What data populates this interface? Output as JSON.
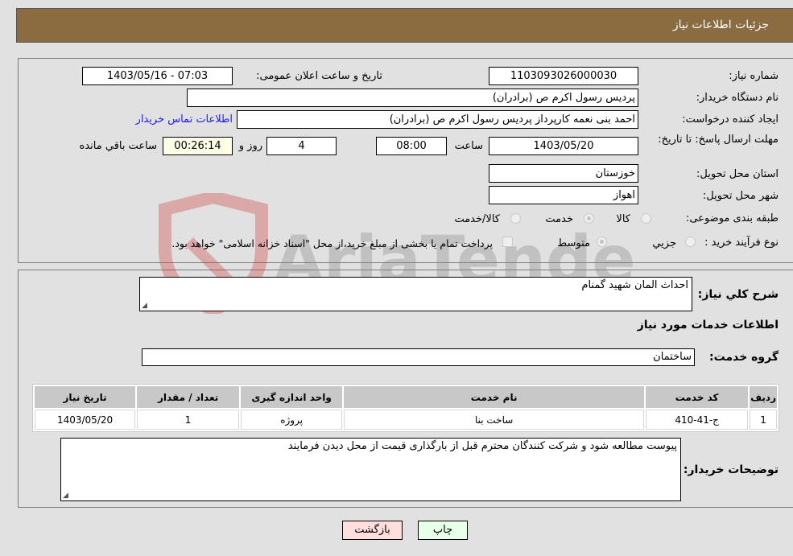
{
  "header": {
    "title": "جزئیات اطلاعات نیاز"
  },
  "fields": {
    "need_number": {
      "label": "شماره نیاز:",
      "value": "1103093026000030"
    },
    "announce_datetime": {
      "label": "تاریخ و ساعت اعلان عمومی:",
      "value": "1403/05/16 - 07:03"
    },
    "buyer_org": {
      "label": "نام دستگاه خریدار:",
      "value": "پردیس رسول اکرم ص (برادران)"
    },
    "requester": {
      "label": "ایجاد کننده درخواست:",
      "value": "احمد بنی نعمه کارپرداز پردیس رسول اکرم ص (برادران)"
    },
    "buyer_contact_link": "اطلاعات تماس خریدار",
    "deadline": {
      "label": "مهلت ارسال پاسخ: تا تاریخ:",
      "date": "1403/05/20",
      "time_label": "ساعت",
      "time": "08:00",
      "days": "4",
      "days_label": "روز و",
      "remaining": "00:26:14",
      "remaining_label": "ساعت باقي مانده"
    },
    "province": {
      "label": "استان محل تحویل:",
      "value": "خوزستان"
    },
    "city": {
      "label": "شهر محل تحویل:",
      "value": "اهواز"
    },
    "category": {
      "label": "طبقه بندی موضوعی:",
      "options": [
        "کالا",
        "خدمت",
        "کالا/خدمت"
      ],
      "selected": "خدمت"
    },
    "purchase_process": {
      "label": "نوع فرآیند خرید :",
      "options": [
        "جزيي",
        "متوسط"
      ],
      "selected": "متوسط",
      "treasury_note": "پرداخت تمام یا بخشی از مبلغ خرید،از محل \"اسناد خزانه اسلامی\" خواهد بود."
    }
  },
  "description": {
    "label": "شرح کلي نياز:",
    "value": "احداث المان شهید گمنام"
  },
  "services_section_title": "اطلاعات خدمات مورد نياز",
  "service_group": {
    "label": "گروه خدمت:",
    "value": "ساختمان"
  },
  "items_table": {
    "headers": [
      "ردیف",
      "کد خدمت",
      "نام خدمت",
      "واحد اندازه گیری",
      "تعداد / مقدار",
      "تاریخ نیاز"
    ],
    "rows": [
      [
        "1",
        "ج-41-410",
        "ساخت بنا",
        "پروژه",
        "1",
        "1403/05/20"
      ]
    ]
  },
  "buyer_notes": {
    "label": "توضیحات خریدار:",
    "value": "پیوست مطالعه شود و شرکت کنندگان محترم قبل از بارگذاری قیمت از محل دیدن فرمایند"
  },
  "buttons": {
    "print": "چاپ",
    "back": "بازگشت"
  },
  "watermark": "AriaTender.neT"
}
